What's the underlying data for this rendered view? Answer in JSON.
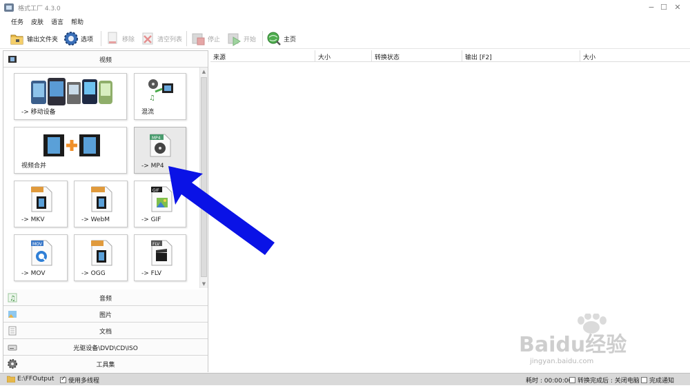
{
  "window": {
    "title": "格式工厂 4.3.0",
    "minimize_glyph": "−",
    "maximize_glyph": "☐",
    "close_glyph": "✕"
  },
  "menu": [
    "任务",
    "皮肤",
    "语言",
    "帮助"
  ],
  "toolbar": {
    "output_folder": "输出文件夹",
    "options": "选项",
    "remove": "移除",
    "clear_list": "清空列表",
    "stop": "停止",
    "start": "开始",
    "home": "主页"
  },
  "categories": {
    "video": "视频",
    "audio": "音频",
    "picture": "图片",
    "document": "文档",
    "disc": "光驱设备\\DVD\\CD\\ISO",
    "tools": "工具集"
  },
  "tiles": {
    "mobile": "-> 移动设备",
    "mux": "混流",
    "join": "视频合并",
    "mp4": "-> MP4",
    "mkv": "-> MKV",
    "webm": "-> WebM",
    "gif": "-> GIF",
    "mov": "-> MOV",
    "ogg": "-> OGG",
    "flv": "-> FLV"
  },
  "tile_badges": {
    "mp4": "MP4",
    "gif": "GIF",
    "mov": "MOV",
    "flv": "FLV"
  },
  "columns": [
    "来源",
    "大小",
    "转换状态",
    "输出 [F2]",
    "大小"
  ],
  "status": {
    "output_path": "E:\\FFOutput",
    "multithread": "使用多线程",
    "elapsed": "耗时 : 00:00:00",
    "shutdown": "转换完成后 : 关闭电脑",
    "notify": "完成通知"
  },
  "watermark": {
    "brand": "Baidu经验",
    "url": "jingyan.baidu.com"
  },
  "colors": {
    "annotation_arrow": "#0a12e6",
    "tile_selected": "#e9e9e9",
    "statusbar": "#d9d9d9"
  },
  "icons": {
    "app": "format-factory-icon",
    "output_folder": "folder-icon",
    "options": "gear-icon",
    "remove": "remove-icon",
    "clear": "clear-list-icon",
    "stop": "stop-icon",
    "start": "start-icon",
    "home": "home-globe-icon"
  }
}
